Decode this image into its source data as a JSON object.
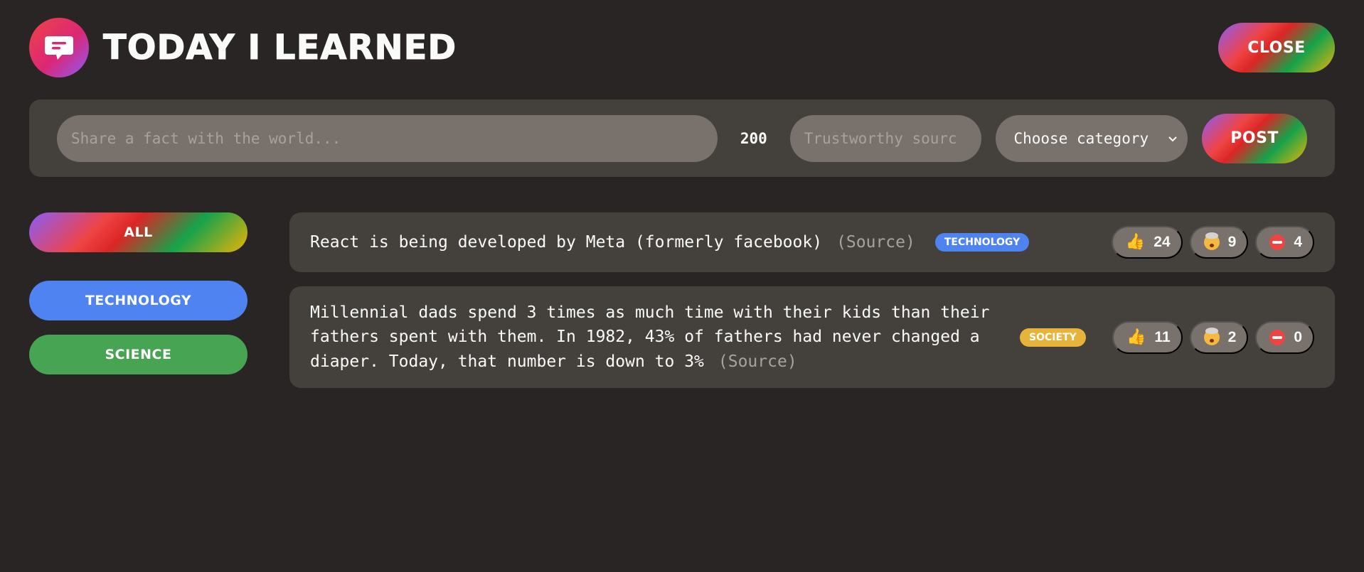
{
  "header": {
    "title": "Today I Learned",
    "close_label": "Close"
  },
  "form": {
    "fact_placeholder": "Share a fact with the world...",
    "char_count": "200",
    "source_placeholder": "Trustworthy sourc",
    "category_selected": "Choose category",
    "post_label": "Post"
  },
  "sidebar": {
    "all_label": "All",
    "categories": [
      {
        "label": "Technology",
        "color": "#4f83f1"
      },
      {
        "label": "Science",
        "color": "#47a452"
      }
    ]
  },
  "facts": [
    {
      "text": "React is being developed by Meta (formerly facebook)",
      "source": "(Source)",
      "tag": "Technology",
      "tag_color": "#4f83f1",
      "votes": {
        "interesting": "24",
        "mindblowing": "9",
        "false": "4"
      }
    },
    {
      "text": "Millennial dads spend 3 times as much time with their kids than their fathers spent with them. In 1982, 43% of fathers had never changed a diaper. Today, that number is down to 3%",
      "source": "(Source)",
      "tag": "Society",
      "tag_color": "#e6b33b",
      "votes": {
        "interesting": "11",
        "mindblowing": "2",
        "false": "0"
      }
    }
  ],
  "icons": {
    "logo": "speech-bubble-icon",
    "vote_interesting": "thumbs-up-icon",
    "vote_mindblowing": "mind-blown-icon",
    "vote_false": "no-entry-icon"
  }
}
